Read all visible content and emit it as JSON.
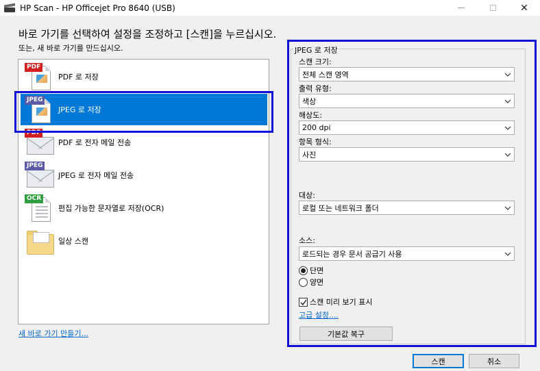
{
  "window": {
    "title": "HP Scan - HP Officejet Pro 8640 (USB)",
    "minimize": "",
    "maximize": "",
    "close": "✕"
  },
  "instruction": "바로 가기를 선택하여 설정을 조정하고 [스캔]을 누르십시오.",
  "sub_instruction": "또는, 새 바로 가기를 만드십시오.",
  "shortcuts": [
    {
      "label": "PDF 로 저장",
      "tag": "PDF",
      "icon": "pdf-document-icon"
    },
    {
      "label": "JPEG 로 저장",
      "tag": "JPEG",
      "icon": "jpeg-document-icon",
      "selected": true
    },
    {
      "label": "PDF 로 전자 메일 전송",
      "tag": "PDF",
      "icon": "pdf-email-icon"
    },
    {
      "label": "JPEG 로 전자 메일 전송",
      "tag": "JPEG",
      "icon": "jpeg-email-icon"
    },
    {
      "label": "편집 가능한 문자열로 저장(OCR)",
      "tag": "OCR",
      "icon": "ocr-document-icon"
    },
    {
      "label": "일상 스캔",
      "icon": "folder-icon"
    }
  ],
  "create_shortcut_link": "새 바로 가기 만들기...",
  "settings": {
    "group_title": "JPEG 로 저장",
    "scan_size_label": "스캔 크기:",
    "scan_size_value": "전체 스캔 영역",
    "output_type_label": "출력 유형:",
    "output_type_value": "색상",
    "resolution_label": "해상도:",
    "resolution_value": "200 dpi",
    "item_type_label": "항목 형식:",
    "item_type_value": "사진",
    "destination_label": "대상:",
    "destination_value": "로컬 또는 네트워크 폴더",
    "source_label": "소스:",
    "source_value": "로드되는 경우 문서 공급기 사용",
    "simplex_label": "단면",
    "duplex_label": "양면",
    "simplex_selected": true,
    "preview_label": "스캔 미리 보기 표시",
    "preview_checked": true,
    "advanced_link": "고급 설정....",
    "reset_button": "기본값 복구"
  },
  "buttons": {
    "scan": "스캔",
    "cancel": "취소"
  },
  "colors": {
    "selection": "#0078d7",
    "highlight_frame": "#1010d8",
    "link": "#0066cc"
  }
}
